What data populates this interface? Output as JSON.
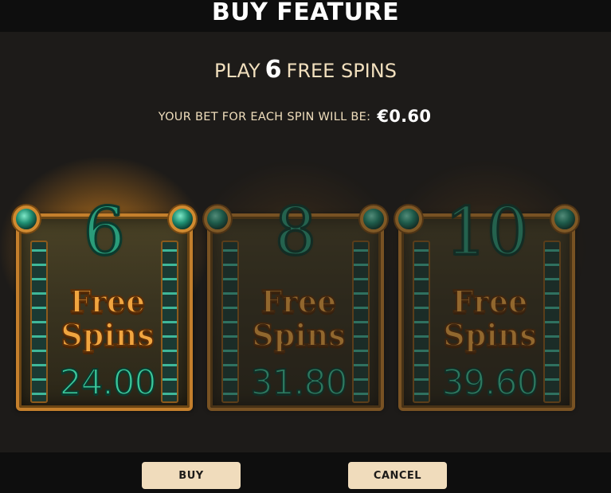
{
  "title": "BUY FEATURE",
  "play": {
    "prefix": "PLAY",
    "count": "6",
    "suffix": "FREE SPINS"
  },
  "bet": {
    "label": "YOUR BET FOR EACH SPIN WILL BE:",
    "value": "€0.60"
  },
  "options": [
    {
      "count": "6",
      "line1": "Free",
      "line2": "Spins",
      "price": "24.00",
      "selected": true
    },
    {
      "count": "8",
      "line1": "Free",
      "line2": "Spins",
      "price": "31.80",
      "selected": false
    },
    {
      "count": "10",
      "line1": "Free",
      "line2": "Spins",
      "price": "39.60",
      "selected": false
    }
  ],
  "buttons": {
    "buy": "BUY",
    "cancel": "CANCEL"
  },
  "colors": {
    "accent_gold": "#c47f2c",
    "accent_green": "#3bc79b",
    "button_bg": "#f0dcbc"
  }
}
